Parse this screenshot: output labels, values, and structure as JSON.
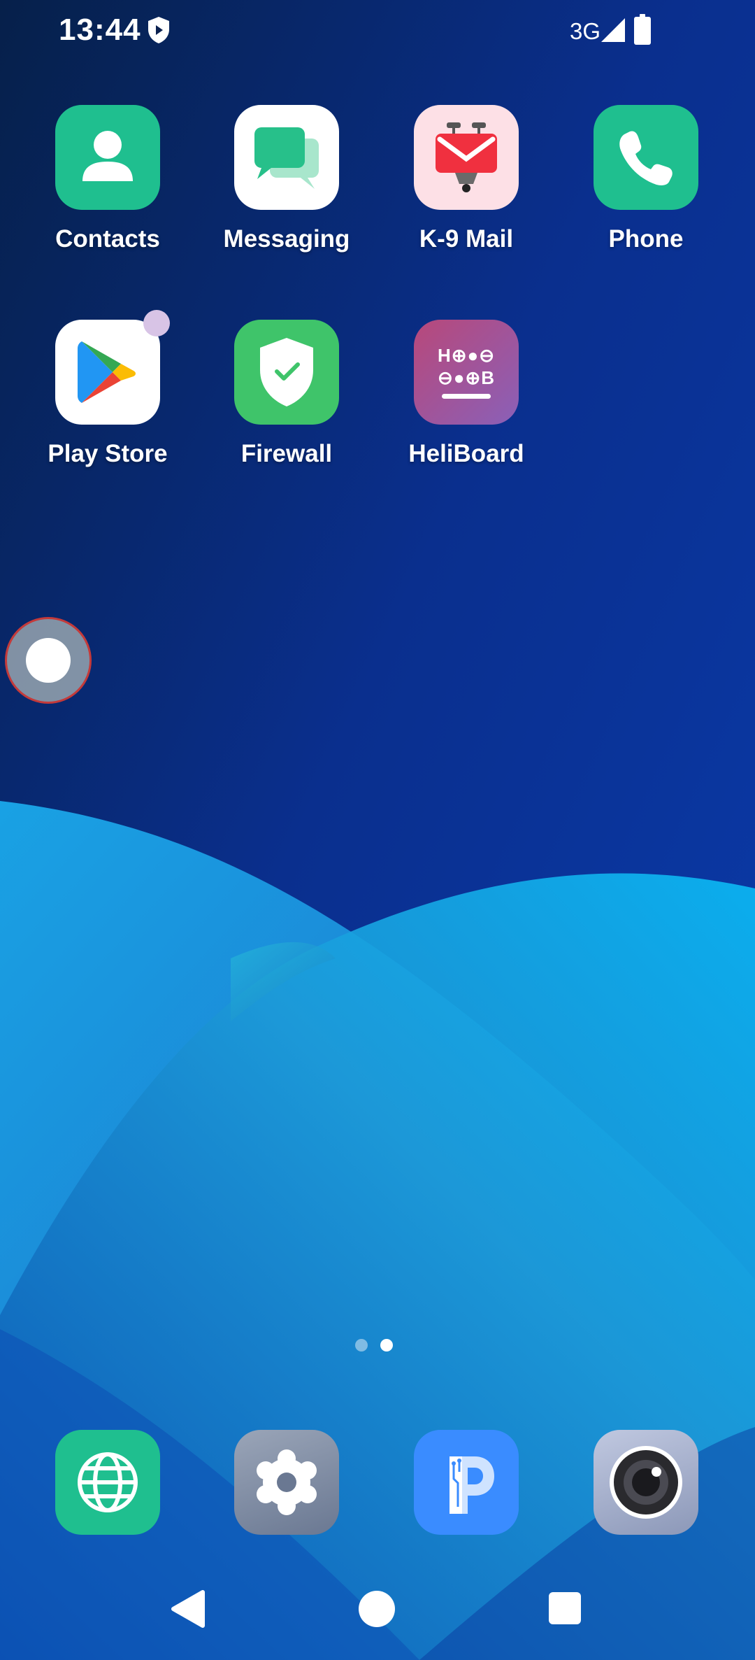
{
  "status_bar": {
    "time": "13:44",
    "network": "3G"
  },
  "apps": [
    {
      "label": "Contacts"
    },
    {
      "label": "Messaging"
    },
    {
      "label": "K-9 Mail"
    },
    {
      "label": "Phone"
    },
    {
      "label": "Play Store"
    },
    {
      "label": "Firewall"
    },
    {
      "label": "HeliBoard"
    }
  ],
  "heliboard_keys": {
    "row1": "H⊕●⊖",
    "row2": "⊖●⊕B"
  },
  "pager": {
    "pages": 2,
    "current": 2
  },
  "dock": [
    {
      "icon": "globe-icon"
    },
    {
      "icon": "settings-icon"
    },
    {
      "icon": "parking-icon"
    },
    {
      "icon": "camera-icon"
    }
  ],
  "colors": {
    "teal": "#1fbf8f",
    "firewall": "#3fc46a",
    "heliboard": "#9b5aa8",
    "dock_blue": "#3a8cff"
  }
}
